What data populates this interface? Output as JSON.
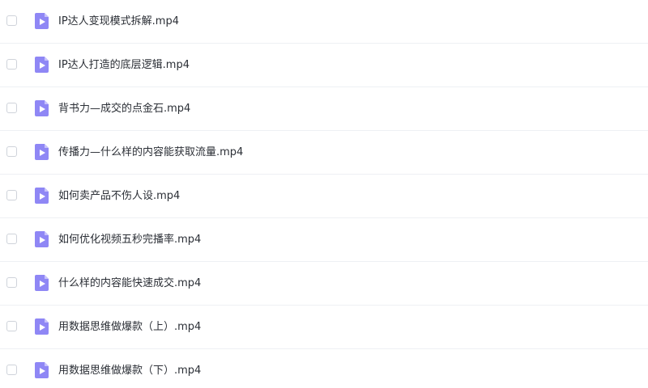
{
  "files": [
    {
      "name": "IP达人变现模式拆解.mp4",
      "icon": "video-file-icon"
    },
    {
      "name": "IP达人打造的底层逻辑.mp4",
      "icon": "video-file-icon"
    },
    {
      "name": "背书力—成交的点金石.mp4",
      "icon": "video-file-icon"
    },
    {
      "name": "传播力—什么样的内容能获取流量.mp4",
      "icon": "video-file-icon"
    },
    {
      "name": "如何卖产品不伤人设.mp4",
      "icon": "video-file-icon"
    },
    {
      "name": "如何优化视频五秒完播率.mp4",
      "icon": "video-file-icon"
    },
    {
      "name": "什么样的内容能快速成交.mp4",
      "icon": "video-file-icon"
    },
    {
      "name": "用数据思维做爆款（上）.mp4",
      "icon": "video-file-icon"
    },
    {
      "name": "用数据思维做爆款（下）.mp4",
      "icon": "video-file-icon"
    }
  ],
  "colors": {
    "icon_accent": "#8f87f5",
    "text": "#2b2f36",
    "divider": "#eef0f4",
    "checkbox_border": "#cfd3da"
  }
}
